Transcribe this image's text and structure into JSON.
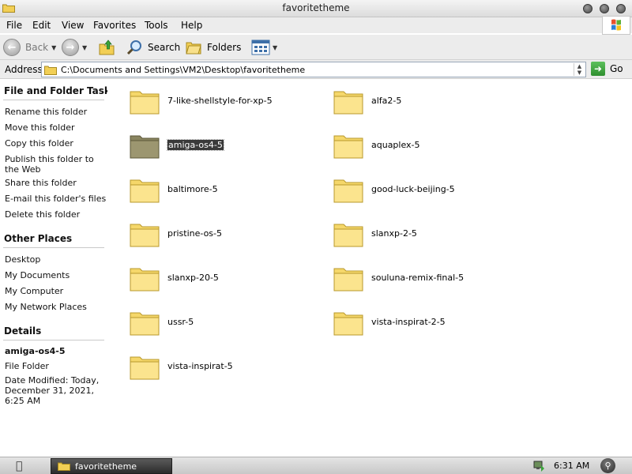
{
  "window": {
    "title": "favoritetheme"
  },
  "menu": [
    "File",
    "Edit",
    "View",
    "Favorites",
    "Tools",
    "Help"
  ],
  "toolbar": {
    "back_label": "Back",
    "search_label": "Search",
    "folders_label": "Folders"
  },
  "address": {
    "label": "Address",
    "value": "C:\\Documents and Settings\\VM2\\Desktop\\favoritetheme",
    "go_label": "Go"
  },
  "sidebar": {
    "file_tasks": {
      "title": "File and Folder Tasks",
      "items": [
        "Rename this folder",
        "Move this folder",
        "Copy this folder",
        "Publish this folder to the Web",
        "Share this folder",
        "E-mail this folder's files",
        "Delete this folder"
      ]
    },
    "other_places": {
      "title": "Other Places",
      "items": [
        "Desktop",
        "My Documents",
        "My Computer",
        "My Network Places"
      ]
    },
    "details": {
      "title": "Details",
      "name": "amiga-os4-5",
      "type": "File Folder",
      "modified": "Date Modified: Today, December 31, 2021, 6:25 AM"
    }
  },
  "folders": [
    {
      "name": "7-like-shellstyle-for-xp-5",
      "selected": false
    },
    {
      "name": "alfa2-5",
      "selected": false
    },
    {
      "name": "amiga-os4-5",
      "selected": true
    },
    {
      "name": "aquaplex-5",
      "selected": false
    },
    {
      "name": "baltimore-5",
      "selected": false
    },
    {
      "name": "good-luck-beijing-5",
      "selected": false
    },
    {
      "name": "pristine-os-5",
      "selected": false
    },
    {
      "name": "slanxp-2-5",
      "selected": false
    },
    {
      "name": "slanxp-20-5",
      "selected": false
    },
    {
      "name": "souluna-remix-final-5",
      "selected": false
    },
    {
      "name": "ussr-5",
      "selected": false
    },
    {
      "name": "vista-inspirat-2-5",
      "selected": false
    },
    {
      "name": "vista-inspirat-5",
      "selected": false
    }
  ],
  "taskbar": {
    "window_button": "favoritetheme",
    "clock": "6:31 AM"
  },
  "colors": {
    "folder_yellow": "#f5d76a",
    "folder_selected": "#8a8560",
    "go_green": "#3aa53a"
  }
}
